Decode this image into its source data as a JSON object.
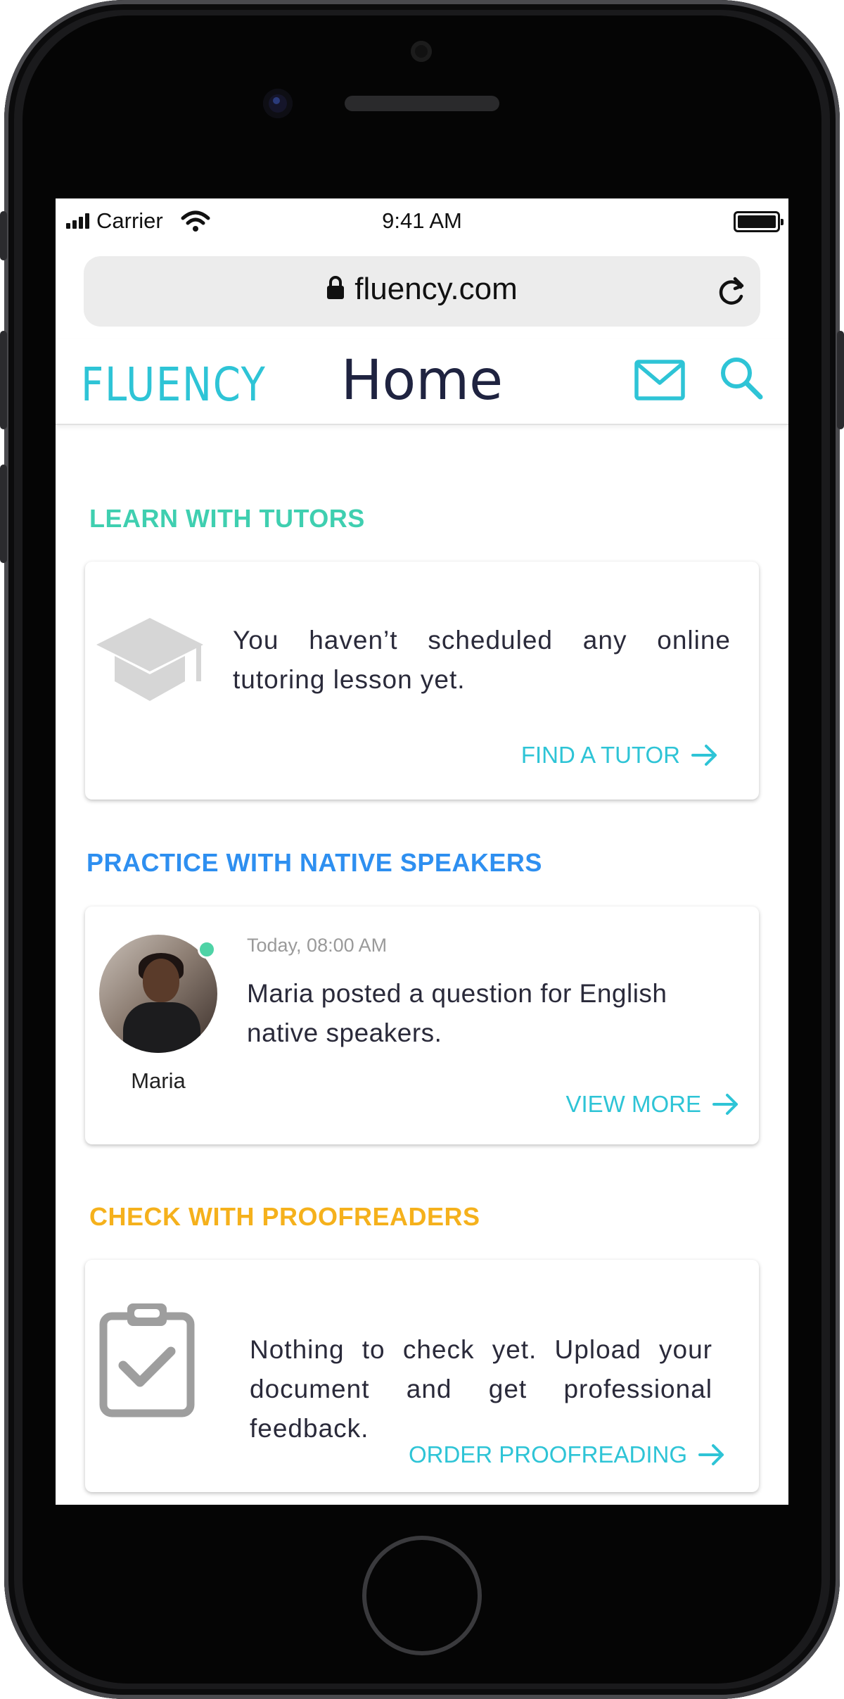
{
  "status_bar": {
    "carrier": "Carrier",
    "time": "9:41 AM"
  },
  "browser": {
    "url": "fluency.com"
  },
  "header": {
    "logo": "FLUENCY",
    "title": "Home"
  },
  "sections": {
    "tutors": {
      "title": "LEARN WITH TUTORS",
      "title_color": "#3fcfb0",
      "message": "You haven’t scheduled any online tutoring lesson yet.",
      "action": "FIND A TUTOR",
      "icon": "graduation-cap-icon"
    },
    "native": {
      "title": "PRACTICE WITH NATIVE SPEAKERS",
      "title_color": "#2e8ff0",
      "timestamp": "Today, 08:00 AM",
      "message": "Maria posted a question for English native speakers.",
      "user_name": "Maria",
      "action": "VIEW MORE"
    },
    "proofreaders": {
      "title": "CHECK WITH PROOFREADERS",
      "title_color": "#f5b11c",
      "message": "Nothing to check yet. Upload your document and get professional feedback.",
      "action": "ORDER PROOFREADING",
      "icon": "clipboard-check-icon"
    }
  },
  "colors": {
    "accent": "#2ec4d6",
    "text": "#1f2340"
  }
}
